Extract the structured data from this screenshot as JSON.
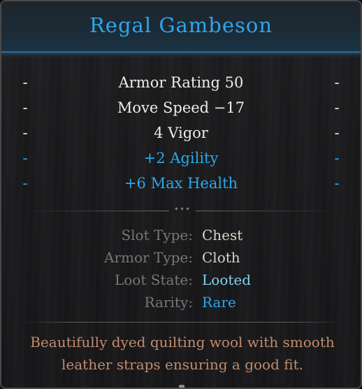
{
  "item": {
    "name": "Regal Gambeson",
    "name_color": "#2da6ec"
  },
  "stats": [
    {
      "label": "Armor Rating 50",
      "color": "white"
    },
    {
      "label": "Move Speed −17",
      "color": "white"
    },
    {
      "label": "4 Vigor",
      "color": "white"
    },
    {
      "label": "+2 Agility",
      "color": "blue"
    },
    {
      "label": "+6 Max Health",
      "color": "blue"
    }
  ],
  "dash": "-",
  "divider_dots": "•••",
  "properties": [
    {
      "key": "Slot Type:",
      "value": "Chest"
    },
    {
      "key": "Armor Type:",
      "value": "Cloth"
    },
    {
      "key": "Loot State:",
      "value": "Looted"
    },
    {
      "key": "Rarity:",
      "value": "Rare"
    }
  ],
  "description": "Beautifully dyed quilting wool with smooth leather straps ensuring a good fit.",
  "colors": {
    "white_stat": "#f0ece6",
    "blue_stat": "#2aa8ec",
    "looted": "#7fd3ef",
    "rare": "#2aa8ec",
    "description": "#c08c6c"
  }
}
